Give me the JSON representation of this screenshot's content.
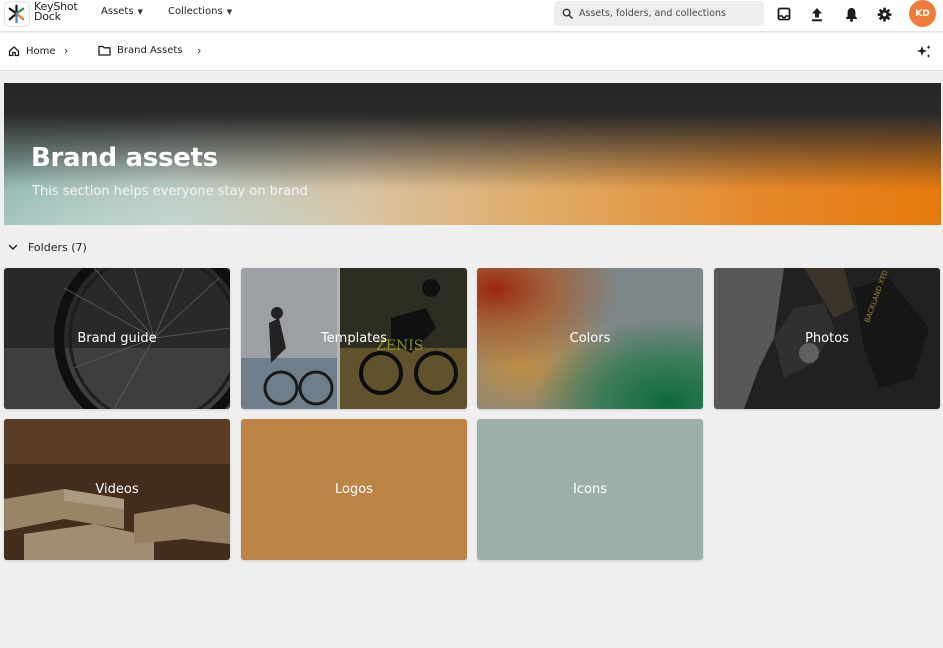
{
  "app": {
    "logo_line1": "KeyShot",
    "logo_line2": "Dock",
    "logo_icon": "keyshot-dock-logo"
  },
  "topnav": {
    "assets_label": "Assets",
    "collections_label": "Collections"
  },
  "search": {
    "placeholder": "Assets, folders, and collections"
  },
  "toolbar_icons": [
    "inbox-icon",
    "upload-icon",
    "bell-icon",
    "gear-icon"
  ],
  "user": {
    "initials": "KD",
    "avatar_color": "#ef7c3a"
  },
  "breadcrumb": {
    "home_label": "Home",
    "current_label": "Brand Assets"
  },
  "hero": {
    "title": "Brand assets",
    "subtitle": "This section helps everyone stay on brand"
  },
  "folders": {
    "heading": "Folders (7)",
    "items": [
      {
        "label": "Brand guide"
      },
      {
        "label": "Templates"
      },
      {
        "label": "Colors"
      },
      {
        "label": "Photos"
      },
      {
        "label": "Videos"
      },
      {
        "label": "Logos",
        "color": "#bb8344"
      },
      {
        "label": "Icons",
        "color": "#9db0a8"
      }
    ]
  }
}
